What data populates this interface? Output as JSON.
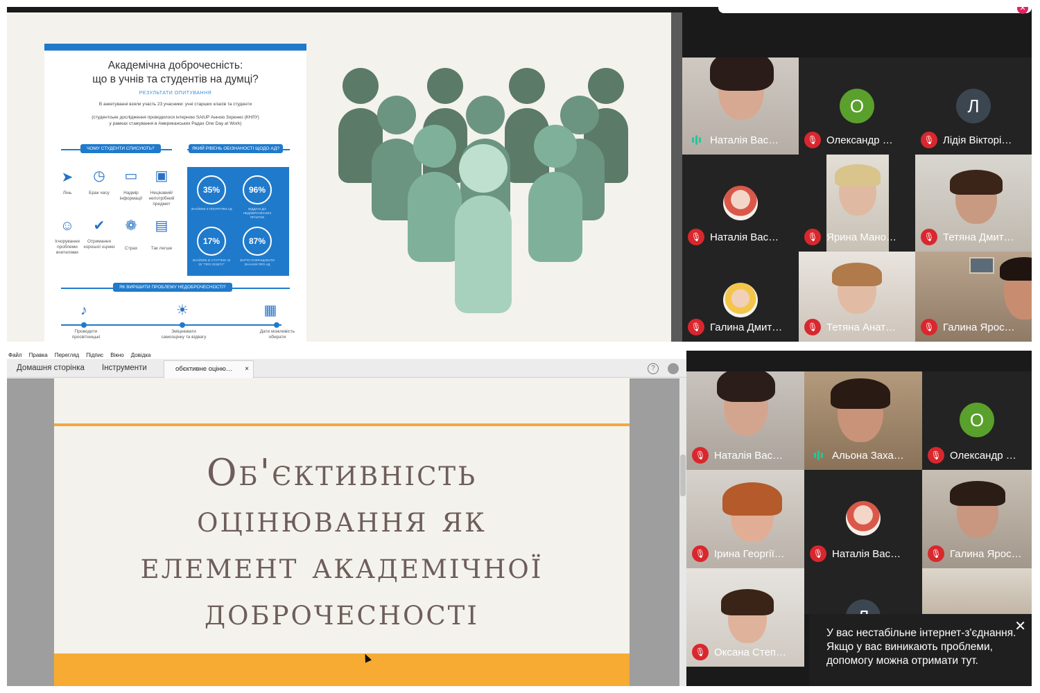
{
  "top": {
    "infographic": {
      "title_line1": "Академічна доброчесність:",
      "title_line2": "що в учнів та студентів на думці?",
      "subtitle": "РЕЗУЛЬТАТИ ОПИТУВАННЯ",
      "intro": "В анкетуванні взяли участь 23 учасники: учні старших класів та студенти",
      "note_line1": "(студентське дослідження проводилося інтерною SAIUP Анною Зоренко (КНЛУ)",
      "note_line2": "у рамках стажування в Американських Радах One Day at Work)",
      "why_header": "ЧОМУ СТУДЕНТИ СПИСУЮТЬ?",
      "level_header": "ЯКИЙ РІВЕНЬ ОБІЗНАНОСТІ ЩОДО АД?",
      "reasons": [
        {
          "label": "Лінь",
          "icon": "paper-plane-icon"
        },
        {
          "label": "Брак часу",
          "icon": "clock-icon"
        },
        {
          "label": "Надмір інформації",
          "icon": "monitor-icon"
        },
        {
          "label": "Нецікавий/ непотрібний предмет",
          "icon": "briefcase-icon"
        },
        {
          "label": "Ігнорування проблеми вчителями",
          "icon": "user-icon"
        },
        {
          "label": "Отримання хорошої оцінки",
          "icon": "check-icon"
        },
        {
          "label": "Страх",
          "icon": "brain-icon"
        },
        {
          "label": "Так легше",
          "icon": "clipboard-icon"
        }
      ],
      "stats": [
        {
          "value": "35%",
          "text": "ЗНАЙОМІ З ПОНЯТТЯМ АД"
        },
        {
          "value": "96%",
          "text": "ВІДДАНІ ДО НЕДОБРОЧЕСНИХ ПРАКТИК"
        },
        {
          "value": "17%",
          "text": "ЗНАЙОМІ ЗІ СТАТТЕЮ 42 ЗУ \"ПРО ОСВІТУ\""
        },
        {
          "value": "87%",
          "text": "ВАРТО ПОКРАЩУВАТИ ЗНАННЯ ПРО АД"
        }
      ],
      "solve_header": "ЯК ВИРІШИТИ ПРОБЛЕМУ НЕДОБРОЧЕСНОСТІ?",
      "solutions": [
        {
          "label": "Проводити просвітницькі",
          "icon": "microphone-icon"
        },
        {
          "label": "Зміцнювати самооцінку та відвагу",
          "icon": "lightbulb-icon"
        },
        {
          "label": "Дати можливість обирати",
          "icon": "newspaper-icon"
        }
      ]
    },
    "participants": [
      {
        "name": "Наталія Вас…",
        "muted": false,
        "speaking": true,
        "kind": "camera"
      },
      {
        "name": "Олександр …",
        "muted": true,
        "kind": "letter",
        "letter": "О",
        "color": "#5aa02c"
      },
      {
        "name": "Лідія Вікторі…",
        "muted": true,
        "kind": "letter",
        "letter": "Л",
        "color": "#3c4650"
      },
      {
        "name": "Наталія Вас…",
        "muted": true,
        "kind": "photo"
      },
      {
        "name": "Ярина Мано…",
        "muted": true,
        "kind": "camera"
      },
      {
        "name": "Тетяна Дмит…",
        "muted": true,
        "kind": "camera"
      },
      {
        "name": "Галина Дмит…",
        "muted": true,
        "kind": "photo"
      },
      {
        "name": "Тетяна Анат…",
        "muted": true,
        "kind": "camera"
      },
      {
        "name": "Галина Ярос…",
        "muted": true,
        "kind": "camera"
      }
    ]
  },
  "bottom": {
    "menu": [
      "Файл",
      "Правка",
      "Перегляд",
      "Підпис",
      "Вікно",
      "Довідка"
    ],
    "tabs": {
      "home": "Домашня сторінка",
      "tools": "Інструменти",
      "document": "обєктивне оціню…",
      "close": "×"
    },
    "help_icon": "?",
    "slide_title": [
      "Об'єктивність",
      "оцінювання як",
      "елемент академічної",
      "доброчесності"
    ],
    "participants": [
      {
        "name": "Наталія Вас…",
        "muted": true,
        "kind": "camera"
      },
      {
        "name": "Альона Заха…",
        "muted": false,
        "speaking": true,
        "kind": "camera"
      },
      {
        "name": "Олександр …",
        "muted": true,
        "kind": "letter",
        "letter": "О",
        "color": "#5aa02c"
      },
      {
        "name": "Ірина Георгії…",
        "muted": true,
        "kind": "camera"
      },
      {
        "name": "Наталія Вас…",
        "muted": true,
        "kind": "photo"
      },
      {
        "name": "Галина Ярос…",
        "muted": true,
        "kind": "camera"
      },
      {
        "name": "Оксана Степ…",
        "muted": true,
        "kind": "camera"
      },
      {
        "name": "",
        "kind": "letter",
        "letter": "Л",
        "color": "#3c4650"
      }
    ],
    "toast": {
      "message": "У вас нестабільне інтернет-з'єднання. Якщо у вас виникають проблеми, допомогу можна отримати тут.",
      "close": "✕"
    }
  }
}
